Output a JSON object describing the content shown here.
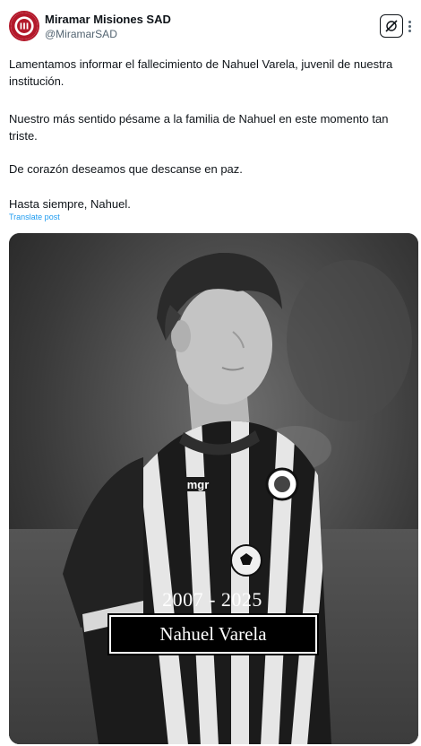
{
  "post": {
    "author": {
      "name": "Miramar Misiones SAD",
      "handle": "@MiramarSAD",
      "avatar_icon": "club-crest-icon"
    },
    "actions": {
      "grok_icon": "grok-icon",
      "more_icon": "more-icon"
    },
    "text": {
      "p1": "Lamentamos informar el fallecimiento de Nahuel Varela, juvenil de nuestra institución.",
      "p2": "Nuestro más sentido pésame a la familia de Nahuel en este momento tan triste.",
      "p3": "De corazón deseamos que descanse en paz.",
      "p4": "Hasta siempre, Nahuel."
    },
    "translate_label": "Translate post",
    "media": {
      "years": "2007 - 2025",
      "name": "Nahuel Varela",
      "shirt_sponsor": "mgr"
    }
  },
  "colors": {
    "link": "#1d9bf0",
    "text": "#0f1419",
    "secondary": "#536471",
    "crest_red": "#b3182a"
  }
}
